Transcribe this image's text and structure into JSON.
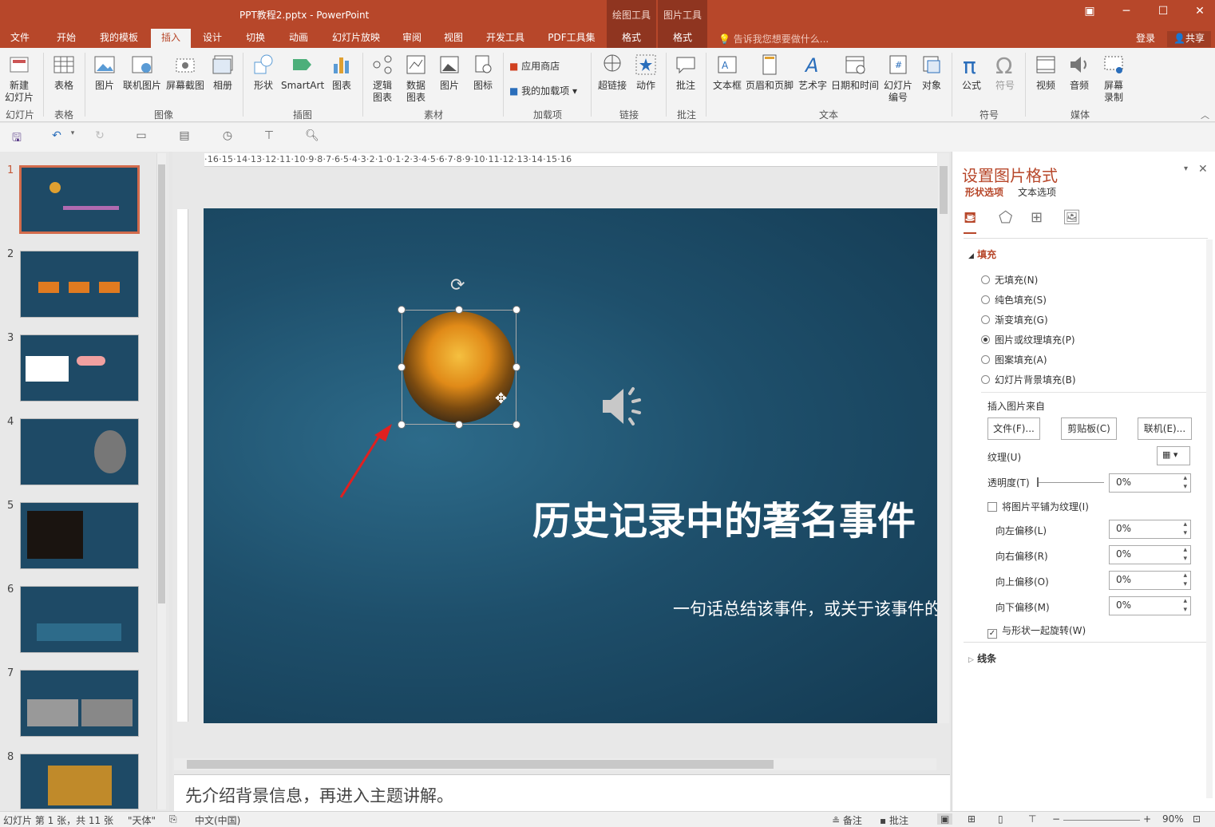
{
  "titlebar": {
    "title": "PPT教程2.pptx - PowerPoint",
    "ctx1": "绘图工具",
    "ctx2": "图片工具"
  },
  "tabs": [
    "文件",
    "开始",
    "我的模板",
    "插入",
    "设计",
    "切换",
    "动画",
    "幻灯片放映",
    "审阅",
    "视图",
    "开发工具",
    "PDF工具集",
    "格式",
    "格式"
  ],
  "tellme": "告诉我您想要做什么...",
  "login": "登录",
  "share": "共享",
  "ribbon": {
    "buttons": [
      "新建\n幻灯片",
      "表格",
      "图片",
      "联机图片",
      "屏幕截图",
      "相册",
      "形状",
      "SmartArt",
      "图表",
      "逻辑\n图表",
      "数据\n图表",
      "图片",
      "图标",
      "超链接",
      "动作",
      "批注",
      "文本框",
      "页眉和页脚",
      "艺术字",
      "日期和时间",
      "幻灯片\n编号",
      "对象",
      "公式",
      "符号",
      "视频",
      "音频",
      "屏幕\n录制"
    ],
    "small": {
      "store": "应用商店",
      "addins": "我的加载项"
    },
    "groups": [
      "幻灯片",
      "表格",
      "图像",
      "插图",
      "素材",
      "加载项",
      "链接",
      "批注",
      "文本",
      "符号",
      "媒体"
    ]
  },
  "thumb_numbers": [
    "1",
    "2",
    "3",
    "4",
    "5",
    "6",
    "7",
    "8"
  ],
  "ruler": {
    "h": "·16·15·14·13·12·11·10·9·8·7·6·5·4·3·2·1·0·1·2·3·4·5·6·7·8·9·10·11·12·13·14·15·16"
  },
  "slide": {
    "title": "历史记录中的著名事件",
    "subtitle": "一句话总结该事件，或关于该事件的"
  },
  "notes": "先介绍背景信息，再进入主题讲解。",
  "pane": {
    "title": "设置图片格式",
    "tab_shape": "形状选项",
    "tab_text": "文本选项",
    "fill": "填充",
    "fill_options": [
      "无填充(N)",
      "纯色填充(S)",
      "渐变填充(G)",
      "图片或纹理填充(P)",
      "图案填充(A)",
      "幻灯片背景填充(B)"
    ],
    "insert_from": "插入图片来自",
    "btn_file": "文件(F)...",
    "btn_clip": "剪贴板(C)",
    "btn_online": "联机(E)...",
    "texture": "纹理(U)",
    "transparency": "透明度(T)",
    "transparency_val": "0%",
    "tile": "将图片平铺为纹理(I)",
    "offset_left": "向左偏移(L)",
    "offset_right": "向右偏移(R)",
    "offset_up": "向上偏移(O)",
    "offset_down": "向下偏移(M)",
    "offset_val": "0%",
    "rotate": "与形状一起旋转(W)",
    "line": "线条"
  },
  "status": {
    "slide": "幻灯片 第 1 张，共 11 张",
    "font": "\"天体\"",
    "lang": "中文(中国)",
    "notes": "备注",
    "comments": "批注",
    "zoom": "90%"
  },
  "colors": {
    "accent": "#b7472a",
    "slide_bg": "#1e4f6b"
  }
}
